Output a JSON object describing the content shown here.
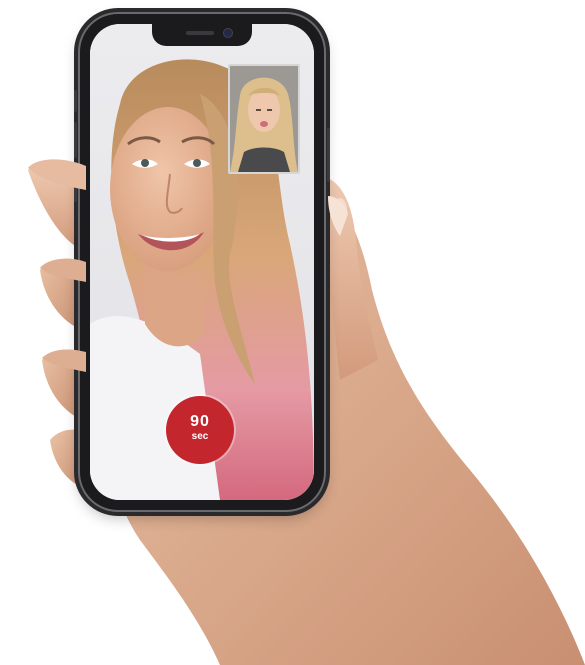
{
  "call": {
    "timer": {
      "value": "90",
      "unit": "sec"
    },
    "accent_color": "#c4262e"
  },
  "icons": {
    "camera": "front-camera-icon"
  }
}
